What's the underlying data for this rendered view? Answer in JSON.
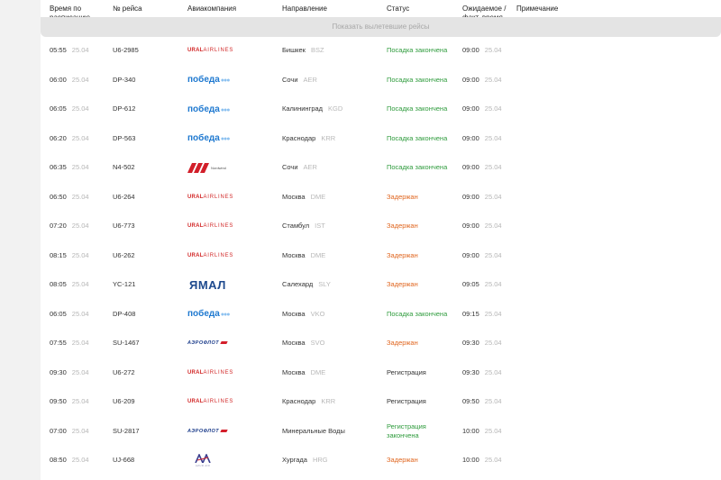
{
  "headers": {
    "scheduled": "Время по расписанию",
    "flight": "№ рейса",
    "airline": "Авиакомпания",
    "destination": "Направление",
    "status": "Статус",
    "expected": "Ожидаемое / факт. время",
    "note": "Примечание"
  },
  "show_departed": "Показать вылетевшие рейсы",
  "logos": {
    "ural": {
      "bold": "URAL",
      "light": "AIRLINES"
    },
    "pobeda": {
      "text": "победа",
      "dots": "●●●"
    },
    "yamal": {
      "text": "ЯМАЛ"
    },
    "aeroflot": {
      "text": "АЭРОФЛОТ"
    },
    "nordwind": {
      "text": "Nordwind"
    },
    "azur": {
      "text": "AZUR AIR"
    }
  },
  "flights": [
    {
      "time": "05:55",
      "date": "25.04",
      "flight": "U6-2985",
      "airline": "ural",
      "city": "Бишкек",
      "code": "BSZ",
      "status": "Посадка закончена",
      "status_type": "board",
      "exp_time": "09:00",
      "exp_date": "25.04"
    },
    {
      "time": "06:00",
      "date": "25.04",
      "flight": "DP-340",
      "airline": "pobeda",
      "city": "Сочи",
      "code": "AER",
      "status": "Посадка закончена",
      "status_type": "board",
      "exp_time": "09:00",
      "exp_date": "25.04"
    },
    {
      "time": "06:05",
      "date": "25.04",
      "flight": "DP-612",
      "airline": "pobeda",
      "city": "Калининград",
      "code": "KGD",
      "status": "Посадка закончена",
      "status_type": "board",
      "exp_time": "09:00",
      "exp_date": "25.04"
    },
    {
      "time": "06:20",
      "date": "25.04",
      "flight": "DP-563",
      "airline": "pobeda",
      "city": "Краснодар",
      "code": "KRR",
      "status": "Посадка закончена",
      "status_type": "board",
      "exp_time": "09:00",
      "exp_date": "25.04"
    },
    {
      "time": "06:35",
      "date": "25.04",
      "flight": "N4-502",
      "airline": "nordwind",
      "city": "Сочи",
      "code": "AER",
      "status": "Посадка закончена",
      "status_type": "board",
      "exp_time": "09:00",
      "exp_date": "25.04"
    },
    {
      "time": "06:50",
      "date": "25.04",
      "flight": "U6-264",
      "airline": "ural",
      "city": "Москва",
      "code": "DME",
      "status": "Задержан",
      "status_type": "delay",
      "exp_time": "09:00",
      "exp_date": "25.04"
    },
    {
      "time": "07:20",
      "date": "25.04",
      "flight": "U6-773",
      "airline": "ural",
      "city": "Стамбул",
      "code": "IST",
      "status": "Задержан",
      "status_type": "delay",
      "exp_time": "09:00",
      "exp_date": "25.04"
    },
    {
      "time": "08:15",
      "date": "25.04",
      "flight": "U6-262",
      "airline": "ural",
      "city": "Москва",
      "code": "DME",
      "status": "Задержан",
      "status_type": "delay",
      "exp_time": "09:00",
      "exp_date": "25.04"
    },
    {
      "time": "08:05",
      "date": "25.04",
      "flight": "YC-121",
      "airline": "yamal",
      "city": "Салехард",
      "code": "SLY",
      "status": "Задержан",
      "status_type": "delay",
      "exp_time": "09:05",
      "exp_date": "25.04"
    },
    {
      "time": "06:05",
      "date": "25.04",
      "flight": "DP-408",
      "airline": "pobeda",
      "city": "Москва",
      "code": "VKO",
      "status": "Посадка закончена",
      "status_type": "board",
      "exp_time": "09:15",
      "exp_date": "25.04"
    },
    {
      "time": "07:55",
      "date": "25.04",
      "flight": "SU-1467",
      "airline": "aeroflot",
      "city": "Москва",
      "code": "SVO",
      "status": "Задержан",
      "status_type": "delay",
      "exp_time": "09:30",
      "exp_date": "25.04"
    },
    {
      "time": "09:30",
      "date": "25.04",
      "flight": "U6-272",
      "airline": "ural",
      "city": "Москва",
      "code": "DME",
      "status": "Регистрация",
      "status_type": "reg",
      "exp_time": "09:30",
      "exp_date": "25.04"
    },
    {
      "time": "09:50",
      "date": "25.04",
      "flight": "U6-209",
      "airline": "ural",
      "city": "Краснодар",
      "code": "KRR",
      "status": "Регистрация",
      "status_type": "reg",
      "exp_time": "09:50",
      "exp_date": "25.04"
    },
    {
      "time": "07:00",
      "date": "25.04",
      "flight": "SU-2817",
      "airline": "aeroflot",
      "city": "Минеральные Воды",
      "code": "",
      "status": "Регистрация закончена",
      "status_type": "board",
      "exp_time": "10:00",
      "exp_date": "25.04"
    },
    {
      "time": "08:50",
      "date": "25.04",
      "flight": "UJ-668",
      "airline": "azur",
      "city": "Хургада",
      "code": "HRG",
      "status": "Задержан",
      "status_type": "delay",
      "exp_time": "10:00",
      "exp_date": "25.04"
    }
  ],
  "colors": {
    "board": "#2e9b3c",
    "delay": "#e0651e",
    "reg": "#333333"
  }
}
